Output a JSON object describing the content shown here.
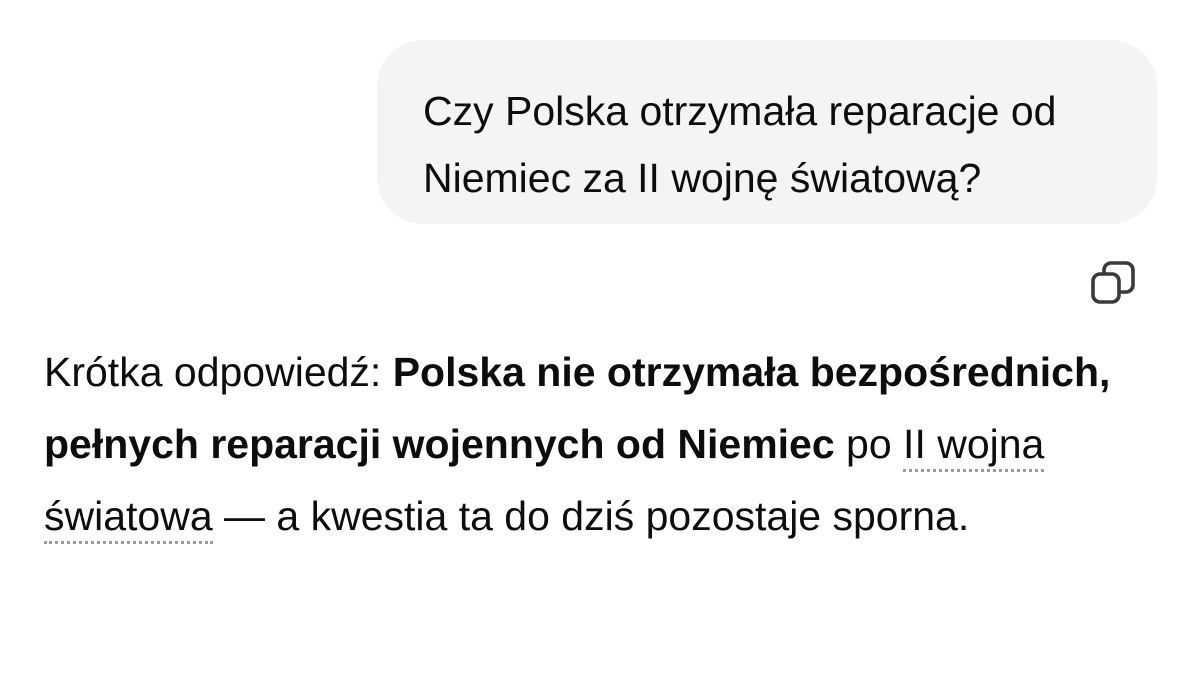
{
  "user_message": {
    "text": "Czy Polska otrzymała reparacje od Niemiec za II wojnę światową?"
  },
  "copy_button": {
    "icon": "copy-icon"
  },
  "answer": {
    "lead": "Krótka odpowiedź: ",
    "bold": "Polska nie otrzymała bezpośrednich, pełnych reparacji wojennych od Niemiec",
    "after_bold": " po ",
    "link_term": "II wojna światowa",
    "tail": " — a kwestia ta do dziś pozostaje sporna."
  },
  "colors": {
    "bubble_bg": "#f4f4f4",
    "text": "#0d0d0d",
    "link_underline": "#9a9a9a"
  }
}
